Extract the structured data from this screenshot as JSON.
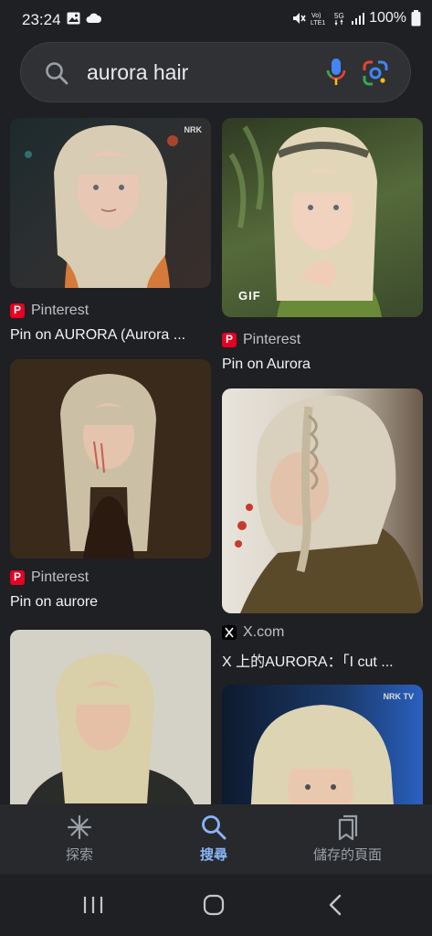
{
  "status_bar": {
    "time": "23:24",
    "battery": "100%"
  },
  "search": {
    "query": "aurora hair"
  },
  "results": [
    {
      "source": "Pinterest",
      "title": "Pin on AURORA (Aurora ...",
      "badge": "",
      "watermark": "NRK"
    },
    {
      "source": "Pinterest",
      "title": "Pin on Aurora",
      "badge": "GIF",
      "watermark": ""
    },
    {
      "source": "Pinterest",
      "title": "Pin on aurore",
      "badge": "",
      "watermark": ""
    },
    {
      "source": "X.com",
      "title": "X 上的AURORA：「I cut ...",
      "badge": "",
      "watermark": ""
    },
    {
      "source": "",
      "title": "",
      "badge": "",
      "watermark": ""
    },
    {
      "source": "",
      "title": "",
      "badge": "",
      "watermark": "NRK TV"
    }
  ],
  "bottom_nav": {
    "items": [
      {
        "label": "探索",
        "icon": "asterisk-icon"
      },
      {
        "label": "搜尋",
        "icon": "search-icon"
      },
      {
        "label": "儲存的頁面",
        "icon": "saved-pages-icon"
      }
    ]
  },
  "colors": {
    "background": "#1f2023",
    "accent": "#8ab4f8",
    "pinterest": "#e60023"
  }
}
